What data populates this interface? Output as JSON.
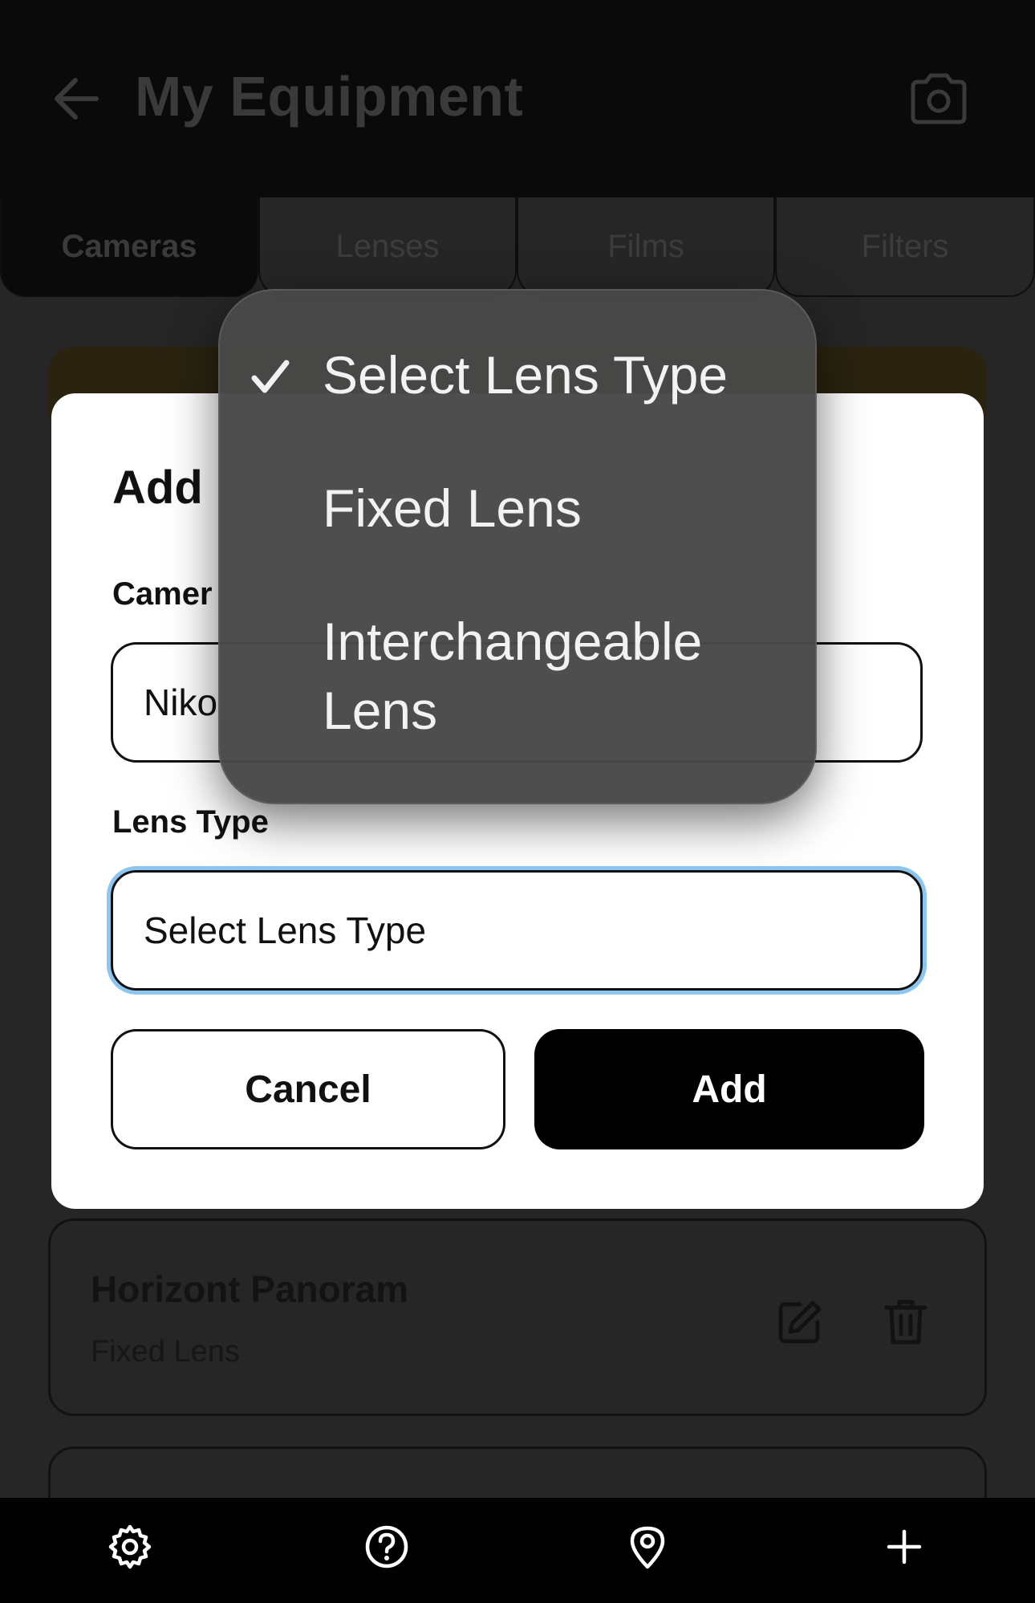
{
  "header": {
    "title": "My Equipment"
  },
  "tabs": [
    {
      "label": "Cameras",
      "active": true
    },
    {
      "label": "Lenses",
      "active": false
    },
    {
      "label": "Films",
      "active": false
    },
    {
      "label": "Filters",
      "active": false
    }
  ],
  "background_list": {
    "card": {
      "name": "Horizont Panoram",
      "lens_type": "Fixed Lens"
    }
  },
  "dialog": {
    "title": "Add",
    "name_label": "Camer",
    "name_value": "Niko",
    "lens_type_label": "Lens Type",
    "lens_type_value": "Select Lens Type",
    "cancel_label": "Cancel",
    "add_label": "Add"
  },
  "lens_type_menu": {
    "options": [
      "Select Lens Type",
      "Fixed Lens",
      "Interchangeable Lens"
    ],
    "selected": "Select Lens Type"
  },
  "bottom_nav": {
    "icons": [
      "gear-icon",
      "help-icon",
      "location-pin-icon",
      "plus-icon"
    ]
  },
  "colors": {
    "focus_ring": "#8cc6f0",
    "primary_button": "#000000",
    "menu_background": "#484848"
  }
}
